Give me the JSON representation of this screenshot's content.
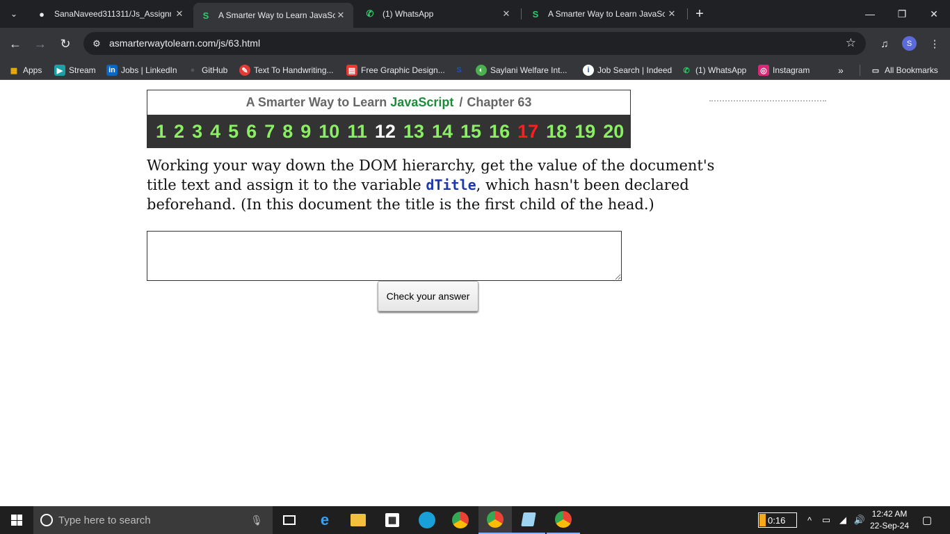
{
  "browser": {
    "tabs": [
      {
        "title": "SanaNaveed311311/Js_Assignm",
        "icon": "github-icon",
        "active": false
      },
      {
        "title": "A Smarter Way to Learn JavaScr",
        "icon": "smarter-way-icon",
        "active": true
      },
      {
        "title": "(1) WhatsApp",
        "icon": "whatsapp-icon",
        "active": false
      },
      {
        "title": "A Smarter Way to Learn JavaScr",
        "icon": "smarter-way-icon",
        "active": false
      }
    ],
    "url": "asmarterwaytolearn.com/js/63.html",
    "profile_initial": "S",
    "bookmarks": [
      {
        "label": "Apps",
        "icon": "apps-grid-icon"
      },
      {
        "label": "Stream",
        "icon": "stream-icon"
      },
      {
        "label": "Jobs | LinkedIn",
        "icon": "linkedin-icon"
      },
      {
        "label": "GitHub",
        "icon": "github-icon"
      },
      {
        "label": "Text To Handwriting...",
        "icon": "handwriting-icon"
      },
      {
        "label": "Free Graphic Design...",
        "icon": "graphic-design-icon"
      },
      {
        "label": "",
        "icon": "saylani-logo-icon"
      },
      {
        "label": "Saylani Welfare Int...",
        "icon": "saylani-icon"
      },
      {
        "label": "Job Search | Indeed",
        "icon": "indeed-icon"
      },
      {
        "label": "(1) WhatsApp",
        "icon": "whatsapp-icon"
      },
      {
        "label": "Instagram",
        "icon": "instagram-icon"
      }
    ],
    "all_bookmarks_label": "All Bookmarks"
  },
  "page": {
    "header_prefix": "A Smarter Way to Learn",
    "header_js": "JavaScript",
    "header_sep": "/",
    "header_chapter": "Chapter 63",
    "exercise_numbers": [
      "1",
      "2",
      "3",
      "4",
      "5",
      "6",
      "7",
      "8",
      "9",
      "10",
      "11",
      "12",
      "13",
      "14",
      "15",
      "16",
      "17",
      "18",
      "19",
      "20"
    ],
    "current_exercise": "12",
    "highlighted_exercise": "17",
    "question_part1": "Working your way down the DOM hierarchy, get the value of the document's title text and assign it to the variable ",
    "question_code": "dTitle",
    "question_part2": ", which hasn't been declared beforehand. (In this document the title is the first child of the head.)",
    "answer_value": "",
    "check_button": "Check your answer"
  },
  "taskbar": {
    "search_placeholder": "Type here to search",
    "battery_text": "0:16",
    "time": "12:42 AM",
    "date": "22-Sep-24"
  },
  "colors": {
    "green_numbers": "#8aef63",
    "current_number": "#ffffff",
    "red_number": "#ff1e1e",
    "javascript_green": "#1a8c3a",
    "code_blue": "#1d3aa8"
  }
}
